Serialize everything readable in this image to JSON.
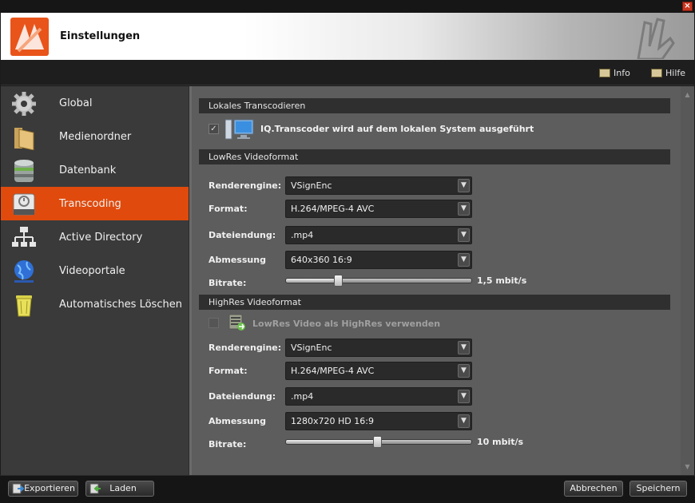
{
  "window": {
    "close_label": "×"
  },
  "header": {
    "title": "Einstellungen"
  },
  "infobar": {
    "info_label": "Info",
    "help_label": "Hilfe"
  },
  "sidebar": {
    "items": [
      {
        "label": "Global",
        "icon": "gear-icon"
      },
      {
        "label": "Medienordner",
        "icon": "folder-icon"
      },
      {
        "label": "Datenbank",
        "icon": "database-icon"
      },
      {
        "label": "Transcoding",
        "icon": "transcoding-icon",
        "active": true
      },
      {
        "label": "Active Directory",
        "icon": "network-tree-icon"
      },
      {
        "label": "Videoportale",
        "icon": "globe-icon"
      },
      {
        "label": "Automatisches Löschen",
        "icon": "trash-bin-icon"
      }
    ]
  },
  "local": {
    "section_title": "Lokales Transcodieren",
    "checkbox_label": "IQ.Transcoder wird auf dem lokalen System ausgeführt",
    "checked": true
  },
  "lowres": {
    "section_title": "LowRes Videoformat",
    "renderengine_label": "Renderengine:",
    "renderengine_value": "VSignEnc",
    "format_label": "Format:",
    "format_value": "H.264/MPEG-4 AVC",
    "extension_label": "Dateiendung:",
    "extension_value": ".mp4",
    "dimension_label": "Abmessung",
    "dimension_value": "640x360 16:9",
    "bitrate_label": "Bitrate:",
    "bitrate_value": "1,5 mbit/s",
    "bitrate_fraction": 0.28
  },
  "highres": {
    "section_title": "HighRes Videoformat",
    "checkbox_label": "LowRes Video als HighRes verwenden",
    "checked": false,
    "renderengine_label": "Renderengine:",
    "renderengine_value": "VSignEnc",
    "format_label": "Format:",
    "format_value": "H.264/MPEG-4 AVC",
    "extension_label": "Dateiendung:",
    "extension_value": ".mp4",
    "dimension_label": "Abmessung",
    "dimension_value": "1280x720 HD 16:9",
    "bitrate_label": "Bitrate:",
    "bitrate_value": "10 mbit/s",
    "bitrate_fraction": 0.49
  },
  "footer": {
    "export_label": "Exportieren",
    "load_label": "Laden",
    "cancel_label": "Abbrechen",
    "save_label": "Speichern"
  },
  "colors": {
    "accent": "#e04a0c",
    "sidebar": "#3a3a3a",
    "content": "#5d5d5d"
  }
}
